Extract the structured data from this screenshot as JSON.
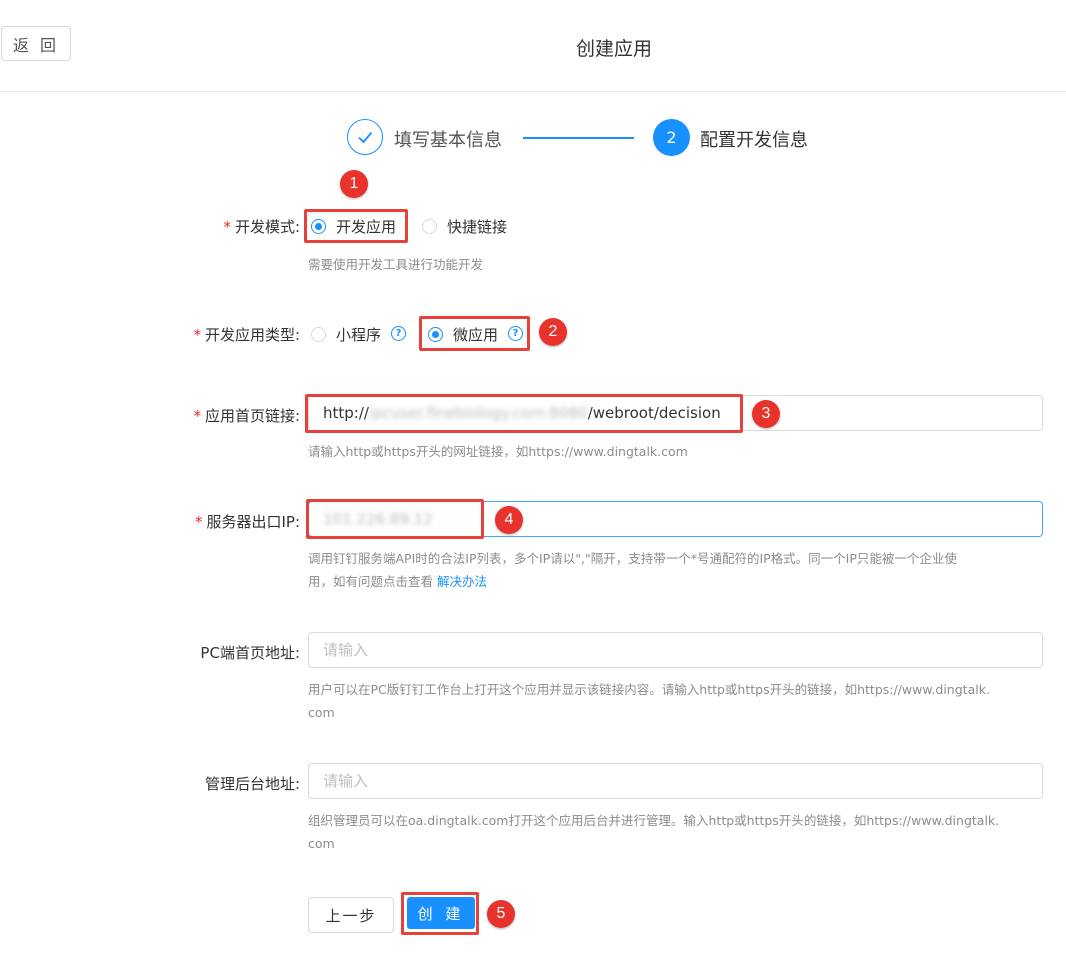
{
  "header": {
    "back_label": "返 回",
    "title": "创建应用"
  },
  "steps": [
    {
      "label": "填写基本信息",
      "status": "done"
    },
    {
      "number": "2",
      "label": "配置开发信息",
      "status": "current"
    }
  ],
  "form": {
    "dev_mode": {
      "label": "开发模式:",
      "options": [
        "开发应用",
        "快捷链接"
      ],
      "selected": "开发应用",
      "help": "需要使用开发工具进行功能开发"
    },
    "app_type": {
      "label": "开发应用类型:",
      "options": [
        "小程序",
        "微应用"
      ],
      "selected": "微应用",
      "help_icon": "?"
    },
    "home_url": {
      "label": "应用首页链接:",
      "value_prefix": "http://",
      "value_hidden": "ipcuser.finebiology.com:8080",
      "value_suffix": "/webroot/decision",
      "help": "请输入http或https开头的网址链接，如https://www.dingtalk.com"
    },
    "server_ip": {
      "label": "服务器出口IP:",
      "value_hidden": "101.226.89.12",
      "help_line1": "调用钉钉服务端API时的合法IP列表，多个IP请以\",\"隔开，支持带一个*号通配符的IP格式。同一个IP只能被一个企业使",
      "help_line2": "用，如有问题点击查看 ",
      "help_link": "解决办法"
    },
    "pc_url": {
      "label": "PC端首页地址:",
      "placeholder": "请输入",
      "help_line1": "用户可以在PC版钉钉工作台上打开这个应用并显示该链接内容。请输入http或https开头的链接，如https://www.dingtalk.",
      "help_line2": "com"
    },
    "admin_url": {
      "label": "管理后台地址:",
      "placeholder": "请输入",
      "help_line1": "组织管理员可以在oa.dingtalk.com打开这个应用后台并进行管理。输入http或https开头的链接，如https://www.dingtalk.",
      "help_line2": "com"
    },
    "required_mark": "*"
  },
  "buttons": {
    "prev": "上一步",
    "create": "创 建"
  },
  "annotations": [
    "1",
    "2",
    "3",
    "4",
    "5"
  ],
  "colors": {
    "primary": "#1890ff",
    "annotation": "#e8403a",
    "required": "#f5222d"
  }
}
